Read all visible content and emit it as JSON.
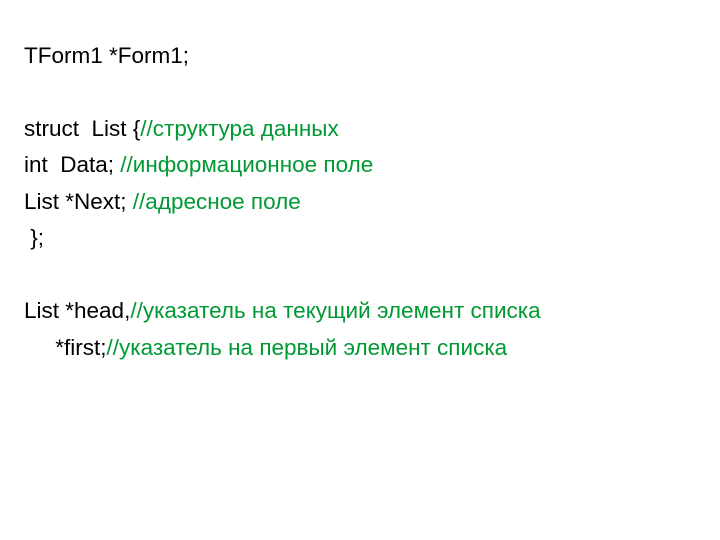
{
  "lines": [
    {
      "segments": [
        {
          "cls": "code",
          "text": "TForm1 *Form1;"
        }
      ]
    },
    {
      "segments": [
        {
          "cls": "code",
          "text": ""
        }
      ]
    },
    {
      "segments": [
        {
          "cls": "code",
          "text": "struct  List {"
        },
        {
          "cls": "comment",
          "text": "//структура данных"
        }
      ]
    },
    {
      "segments": [
        {
          "cls": "code",
          "text": "int  Data; "
        },
        {
          "cls": "comment",
          "text": "//информационное поле"
        }
      ]
    },
    {
      "segments": [
        {
          "cls": "code",
          "text": "List *Next; "
        },
        {
          "cls": "comment",
          "text": "//адресное поле"
        }
      ]
    },
    {
      "segments": [
        {
          "cls": "code",
          "text": " };"
        }
      ]
    },
    {
      "segments": [
        {
          "cls": "code",
          "text": ""
        }
      ]
    },
    {
      "segments": [
        {
          "cls": "code",
          "text": "List *head,"
        },
        {
          "cls": "comment",
          "text": "//указатель на текущий элемент списка"
        }
      ]
    },
    {
      "segments": [
        {
          "cls": "code",
          "text": "     *first;"
        },
        {
          "cls": "comment",
          "text": "//указатель на первый элемент списка"
        }
      ]
    }
  ]
}
